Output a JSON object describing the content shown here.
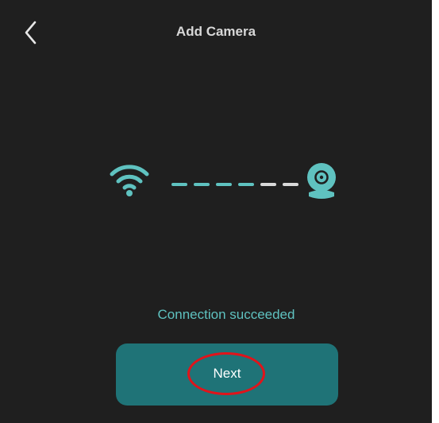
{
  "header": {
    "title": "Add Camera",
    "back_icon": "chevron-left-icon"
  },
  "connection": {
    "wifi_icon": "wifi-icon",
    "camera_icon": "camera-icon",
    "progress_dashes": {
      "completed": 4,
      "total": 6
    },
    "status_text": "Connection succeeded"
  },
  "actions": {
    "next_label": "Next"
  },
  "colors": {
    "background": "#1f1f1f",
    "accent": "#5fc2c0",
    "button": "#1f7377",
    "dash_complete": "#5fc2c0",
    "dash_pending": "#d9d9d9",
    "highlight_ring": "#e0141b"
  }
}
